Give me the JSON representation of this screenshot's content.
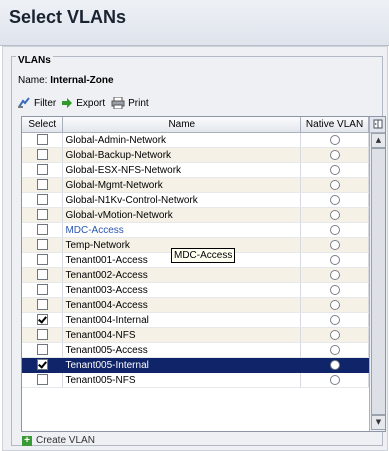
{
  "title": "Select VLANs",
  "group_legend": "VLANs",
  "name_label": "Name:",
  "name_value": "Internal-Zone",
  "toolbar": {
    "filter": "Filter",
    "export": "Export",
    "print": "Print"
  },
  "columns": {
    "select": "Select",
    "name": "Name",
    "native": "Native VLAN"
  },
  "rows": [
    {
      "name": "Global-Admin-Network",
      "checked": false,
      "link": false
    },
    {
      "name": "Global-Backup-Network",
      "checked": false,
      "link": false
    },
    {
      "name": "Global-ESX-NFS-Network",
      "checked": false,
      "link": false
    },
    {
      "name": "Global-Mgmt-Network",
      "checked": false,
      "link": false
    },
    {
      "name": "Global-N1Kv-Control-Network",
      "checked": false,
      "link": false
    },
    {
      "name": "Global-vMotion-Network",
      "checked": false,
      "link": false
    },
    {
      "name": "MDC-Access",
      "checked": false,
      "link": true
    },
    {
      "name": "Temp-Network",
      "checked": false,
      "link": false
    },
    {
      "name": "Tenant001-Access",
      "checked": false,
      "link": false
    },
    {
      "name": "Tenant002-Access",
      "checked": false,
      "link": false
    },
    {
      "name": "Tenant003-Access",
      "checked": false,
      "link": false
    },
    {
      "name": "Tenant004-Access",
      "checked": false,
      "link": false
    },
    {
      "name": "Tenant004-Internal",
      "checked": true,
      "link": false
    },
    {
      "name": "Tenant004-NFS",
      "checked": false,
      "link": false
    },
    {
      "name": "Tenant005-Access",
      "checked": false,
      "link": false
    },
    {
      "name": "Tenant005-Internal",
      "checked": true,
      "link": false,
      "selected": true
    },
    {
      "name": "Tenant005-NFS",
      "checked": false,
      "link": false
    }
  ],
  "tooltip": "MDC-Access",
  "create_vlan": "Create VLAN",
  "colors": {
    "selected_row": "#10246a",
    "alt_row": "#f5f1e6",
    "link": "#2a55b0",
    "add_icon": "#3a9a36"
  }
}
